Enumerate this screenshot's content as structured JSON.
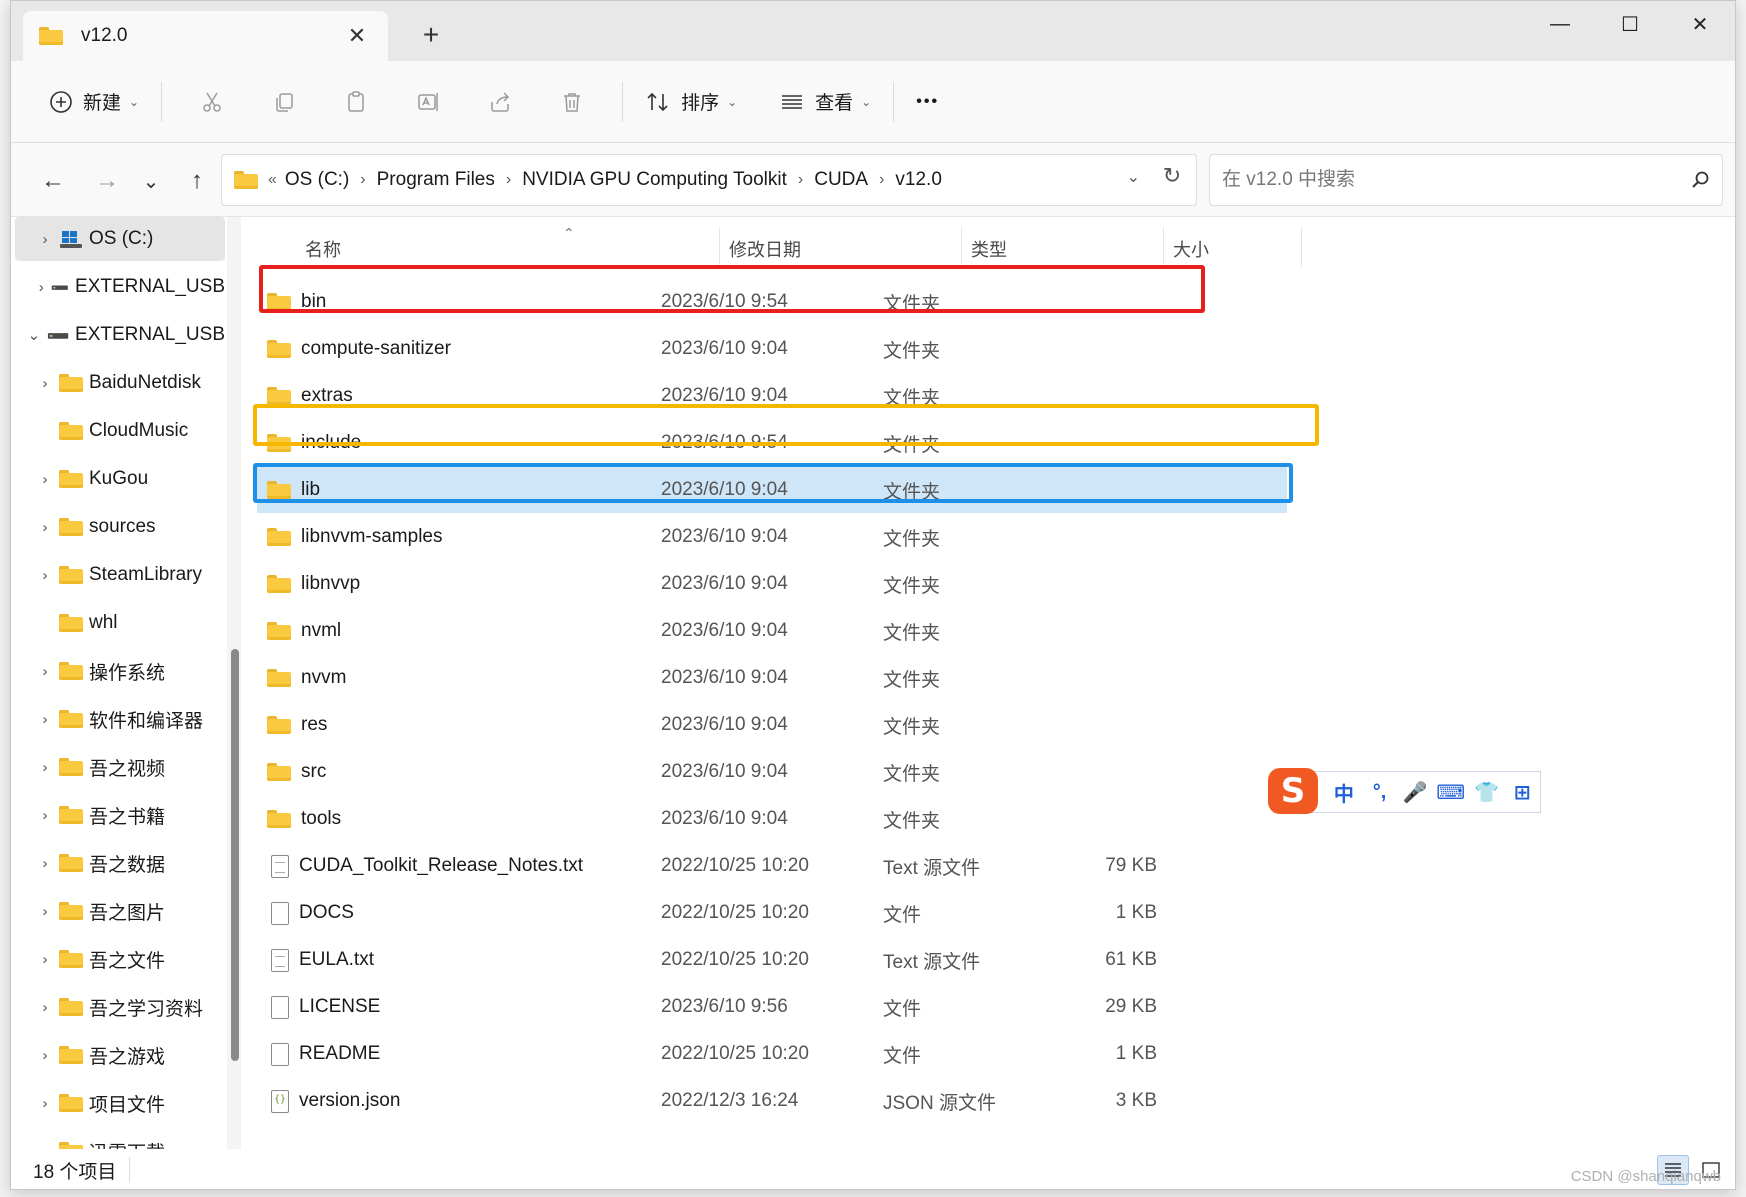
{
  "tab": {
    "title": "v12.0",
    "close": "✕",
    "new_tab": "+"
  },
  "window_controls": {
    "minimize": "—",
    "maximize": "☐",
    "close": "✕"
  },
  "commandbar": {
    "new_label": "新建",
    "sort_label": "排序",
    "view_label": "查看",
    "more": "•••",
    "icons": [
      "cut-icon",
      "copy-icon",
      "paste-icon",
      "rename-icon",
      "share-icon",
      "delete-icon"
    ]
  },
  "nav": {
    "back": "←",
    "forward": "→",
    "recent": "⌄",
    "up": "↑"
  },
  "address": {
    "overflow": "«",
    "crumbs": [
      "OS (C:)",
      "Program Files",
      "NVIDIA GPU Computing Toolkit",
      "CUDA",
      "v12.0"
    ],
    "separator": "›",
    "dropdown": "⌄",
    "refresh": "↻"
  },
  "search": {
    "placeholder": "在 v12.0 中搜索"
  },
  "sidebar": {
    "items": [
      {
        "label": "OS (C:)",
        "chevron": "›",
        "icon": "windows-drive-icon"
      },
      {
        "label": "EXTERNAL_USB",
        "chevron": "›",
        "icon": "drive-icon"
      },
      {
        "label": "EXTERNAL_USB",
        "chevron": "⌄",
        "icon": "drive-icon"
      },
      {
        "label": "BaiduNetdisk",
        "chevron": "›",
        "icon": "folder-icon"
      },
      {
        "label": "CloudMusic",
        "chevron": "",
        "icon": "folder-icon"
      },
      {
        "label": "KuGou",
        "chevron": "›",
        "icon": "folder-icon"
      },
      {
        "label": "sources",
        "chevron": "›",
        "icon": "folder-icon"
      },
      {
        "label": "SteamLibrary",
        "chevron": "›",
        "icon": "folder-icon"
      },
      {
        "label": "whl",
        "chevron": "",
        "icon": "folder-icon"
      },
      {
        "label": "操作系统",
        "chevron": "›",
        "icon": "folder-icon"
      },
      {
        "label": "软件和编译器",
        "chevron": "›",
        "icon": "folder-icon"
      },
      {
        "label": "吾之视频",
        "chevron": "›",
        "icon": "folder-icon"
      },
      {
        "label": "吾之书籍",
        "chevron": "›",
        "icon": "folder-icon"
      },
      {
        "label": "吾之数据",
        "chevron": "›",
        "icon": "folder-icon"
      },
      {
        "label": "吾之图片",
        "chevron": "›",
        "icon": "folder-icon"
      },
      {
        "label": "吾之文件",
        "chevron": "›",
        "icon": "folder-icon"
      },
      {
        "label": "吾之学习资料",
        "chevron": "›",
        "icon": "folder-icon"
      },
      {
        "label": "吾之游戏",
        "chevron": "›",
        "icon": "folder-icon"
      },
      {
        "label": "项目文件",
        "chevron": "›",
        "icon": "folder-icon"
      },
      {
        "label": "迅雷下载",
        "chevron": "",
        "icon": "folder-icon"
      }
    ]
  },
  "columns": {
    "name": "名称",
    "date": "修改日期",
    "type": "类型",
    "size": "大小",
    "sort_indicator": "⌃"
  },
  "files": [
    {
      "name": "bin",
      "date": "2023/6/10 9:54",
      "type": "文件夹",
      "size": "",
      "icon": "folder"
    },
    {
      "name": "compute-sanitizer",
      "date": "2023/6/10 9:04",
      "type": "文件夹",
      "size": "",
      "icon": "folder"
    },
    {
      "name": "extras",
      "date": "2023/6/10 9:04",
      "type": "文件夹",
      "size": "",
      "icon": "folder"
    },
    {
      "name": "include",
      "date": "2023/6/10 9:54",
      "type": "文件夹",
      "size": "",
      "icon": "folder"
    },
    {
      "name": "lib",
      "date": "2023/6/10 9:04",
      "type": "文件夹",
      "size": "",
      "icon": "folder"
    },
    {
      "name": "libnvvm-samples",
      "date": "2023/6/10 9:04",
      "type": "文件夹",
      "size": "",
      "icon": "folder"
    },
    {
      "name": "libnvvp",
      "date": "2023/6/10 9:04",
      "type": "文件夹",
      "size": "",
      "icon": "folder"
    },
    {
      "name": "nvml",
      "date": "2023/6/10 9:04",
      "type": "文件夹",
      "size": "",
      "icon": "folder"
    },
    {
      "name": "nvvm",
      "date": "2023/6/10 9:04",
      "type": "文件夹",
      "size": "",
      "icon": "folder"
    },
    {
      "name": "res",
      "date": "2023/6/10 9:04",
      "type": "文件夹",
      "size": "",
      "icon": "folder"
    },
    {
      "name": "src",
      "date": "2023/6/10 9:04",
      "type": "文件夹",
      "size": "",
      "icon": "folder"
    },
    {
      "name": "tools",
      "date": "2023/6/10 9:04",
      "type": "文件夹",
      "size": "",
      "icon": "folder"
    },
    {
      "name": "CUDA_Toolkit_Release_Notes.txt",
      "date": "2022/10/25 10:20",
      "type": "Text 源文件",
      "size": "79 KB",
      "icon": "txt"
    },
    {
      "name": "DOCS",
      "date": "2022/10/25 10:20",
      "type": "文件",
      "size": "1 KB",
      "icon": "file"
    },
    {
      "name": "EULA.txt",
      "date": "2022/10/25 10:20",
      "type": "Text 源文件",
      "size": "61 KB",
      "icon": "txt"
    },
    {
      "name": "LICENSE",
      "date": "2023/6/10 9:56",
      "type": "文件",
      "size": "29 KB",
      "icon": "file"
    },
    {
      "name": "README",
      "date": "2022/10/25 10:20",
      "type": "文件",
      "size": "1 KB",
      "icon": "file"
    },
    {
      "name": "version.json",
      "date": "2022/12/3 16:24",
      "type": "JSON 源文件",
      "size": "3 KB",
      "icon": "json"
    }
  ],
  "selected_row": "lib",
  "annotation_colors": {
    "bin": "#e8201c",
    "include": "#f5b700",
    "lib": "#1e90e8"
  },
  "ime": {
    "logo": "S",
    "items": [
      "中",
      "°,",
      "🎤",
      "⌨",
      "👕",
      "⊞"
    ]
  },
  "status": {
    "count_text": "18 个项目"
  },
  "watermark": "CSDN @shanqianqwb"
}
